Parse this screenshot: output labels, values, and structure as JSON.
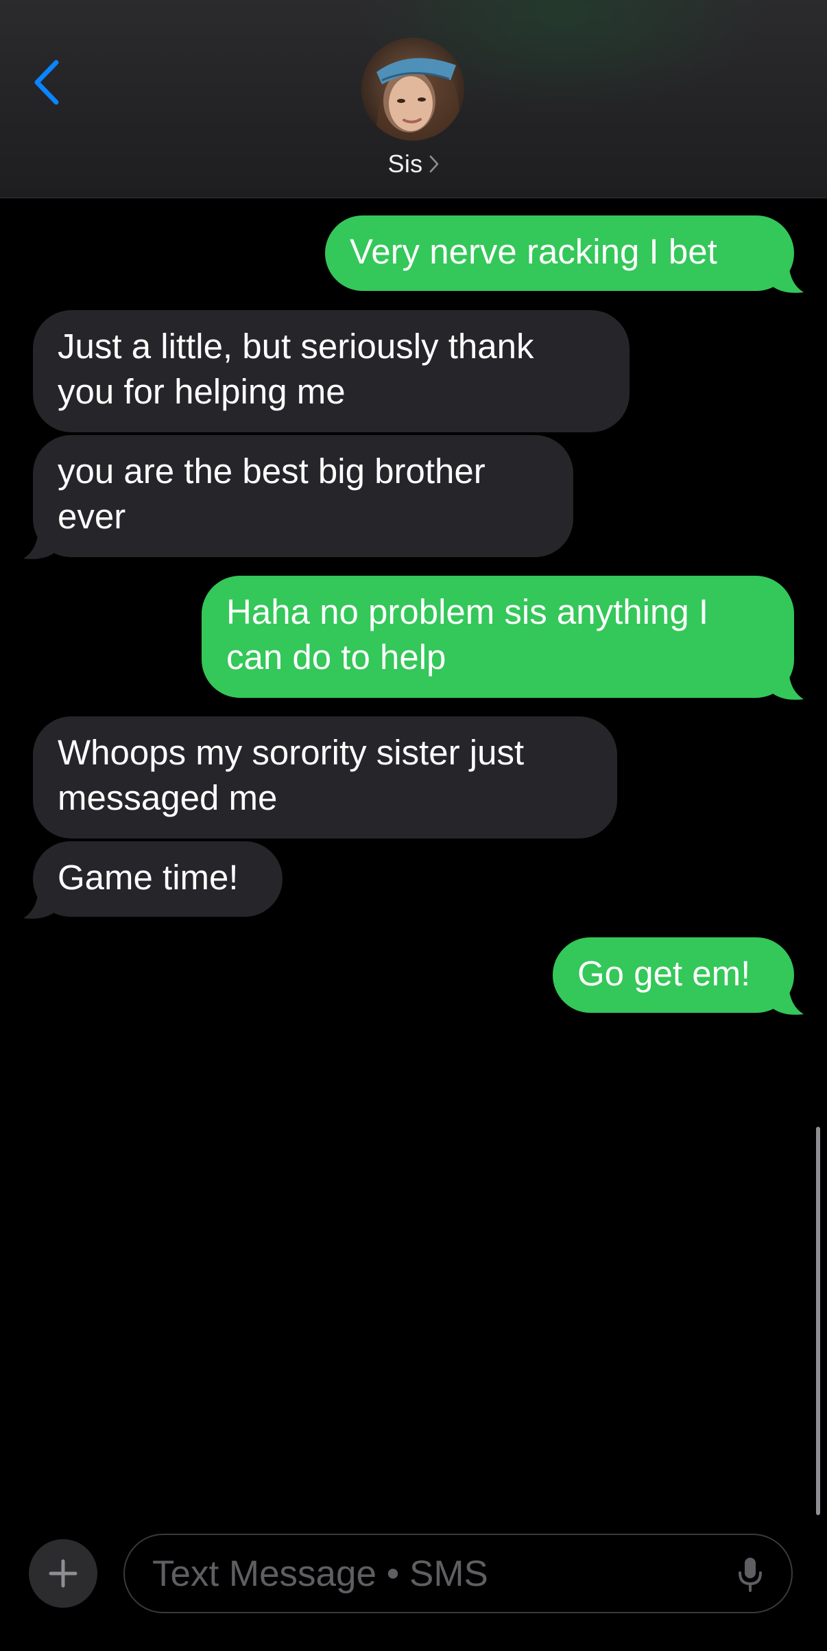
{
  "header": {
    "contact_name": "Sis"
  },
  "messages": [
    {
      "direction": "sent",
      "text": "Very nerve racking I bet"
    },
    {
      "direction": "received",
      "text": "Just a little, but seriously thank\nyou for helping me"
    },
    {
      "direction": "received",
      "text": "you are the best big brother\never"
    },
    {
      "direction": "sent",
      "text": "Haha no problem sis anything I\ncan do to help"
    },
    {
      "direction": "received",
      "text": "Whoops my sorority sister just\nmessaged me"
    },
    {
      "direction": "received",
      "text": "Game time!"
    },
    {
      "direction": "sent",
      "text": "Go get em!"
    }
  ],
  "composer": {
    "placeholder": "Text Message • SMS"
  },
  "colors": {
    "sent_bubble": "#34c759",
    "received_bubble": "#26262a",
    "accent": "#0a84ff",
    "background": "#000000"
  },
  "icons": {
    "back": "chevron-left-icon",
    "contact_disclosure": "chevron-right-icon",
    "add": "plus-icon",
    "dictation": "microphone-icon"
  }
}
